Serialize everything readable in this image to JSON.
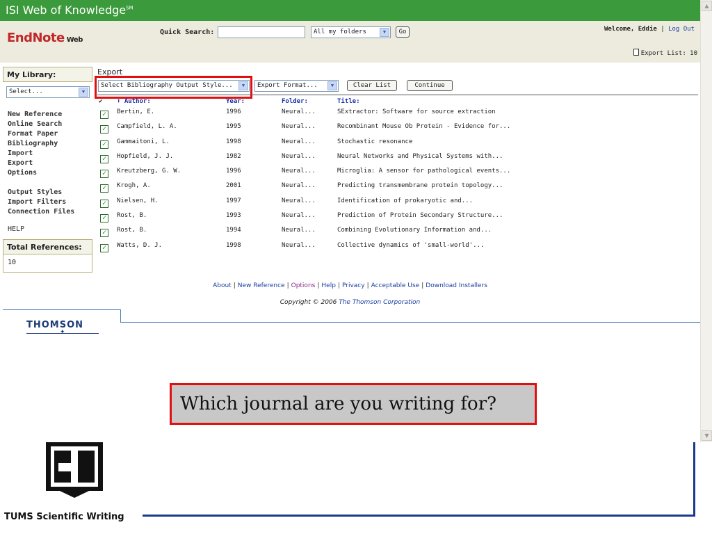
{
  "topbar": {
    "title": "ISI Web of Knowledge",
    "sup": "SM"
  },
  "header": {
    "logo": "EndNote",
    "logo_sub": "Web",
    "quick_search_label": "Quick Search:",
    "quick_search_value": "",
    "folder_select": "All my folders",
    "go_label": "Go",
    "welcome_text": "Welcome, Eddie",
    "logout_label": "Log Out",
    "export_list_label": "Export List: 10"
  },
  "sidebar": {
    "my_library_label": "My Library:",
    "select_label": "Select...",
    "group1": [
      "New Reference",
      "Online Search",
      "Format Paper",
      "Bibliography",
      "Import",
      "Export",
      "Options"
    ],
    "group2": [
      "Output Styles",
      "Import Filters",
      "Connection Files"
    ],
    "help_label": "HELP",
    "total_label": "Total References:",
    "total_value": "10"
  },
  "export": {
    "title": "Export",
    "style_select": "Select Bibliography Output Style...",
    "format_select": "Export Format...",
    "clear_label": "Clear List",
    "continue_label": "Continue"
  },
  "table": {
    "headers": {
      "check": "✔",
      "author": "⬆ Author:",
      "year": "Year:",
      "folder": "Folder:",
      "title": "Title:"
    },
    "rows": [
      {
        "author": "Bertin, E.",
        "year": "1996",
        "folder": "Neural...",
        "title": "SExtractor: Software for source extraction"
      },
      {
        "author": "Campfield, L. A.",
        "year": "1995",
        "folder": "Neural...",
        "title": "Recombinant Mouse Ob Protein - Evidence for..."
      },
      {
        "author": "Gammaitoni, L.",
        "year": "1998",
        "folder": "Neural...",
        "title": "Stochastic resonance"
      },
      {
        "author": "Hopfield, J. J.",
        "year": "1982",
        "folder": "Neural...",
        "title": "Neural Networks and Physical Systems with..."
      },
      {
        "author": "Kreutzberg, G. W.",
        "year": "1996",
        "folder": "Neural...",
        "title": "Microglia: A sensor for pathological events..."
      },
      {
        "author": "Krogh, A.",
        "year": "2001",
        "folder": "Neural...",
        "title": "Predicting transmembrane protein topology..."
      },
      {
        "author": "Nielsen, H.",
        "year": "1997",
        "folder": "Neural...",
        "title": "Identification of prokaryotic and..."
      },
      {
        "author": "Rost, B.",
        "year": "1993",
        "folder": "Neural...",
        "title": "Prediction of Protein Secondary Structure..."
      },
      {
        "author": "Rost, B.",
        "year": "1994",
        "folder": "Neural...",
        "title": "Combining Evolutionary Information and..."
      },
      {
        "author": "Watts, D. J.",
        "year": "1998",
        "folder": "Neural...",
        "title": "Collective dynamics of 'small-world'..."
      }
    ]
  },
  "footer": {
    "links": [
      "About",
      "New Reference",
      "Options",
      "Help",
      "Privacy",
      "Acceptable Use",
      "Download Installers"
    ],
    "copyright_prefix": "Copyright © 2006 ",
    "copyright_corp": "The Thomson Corporation",
    "thomson_logo": "THOMSON"
  },
  "callout": {
    "text": "Which journal are you writing for?"
  },
  "slide": {
    "footer_label": "TUMS Scientific Writing"
  },
  "colors": {
    "accent_green": "#3b9a3b",
    "highlight_red": "#e01010",
    "link_blue": "#1a3fa3",
    "rule_blue": "#1a3a8a"
  },
  "icons": {
    "scroll_up": "arrow-up-icon",
    "scroll_down": "arrow-down-icon",
    "export_doc": "document-icon",
    "dropdown": "chevron-down-icon"
  }
}
